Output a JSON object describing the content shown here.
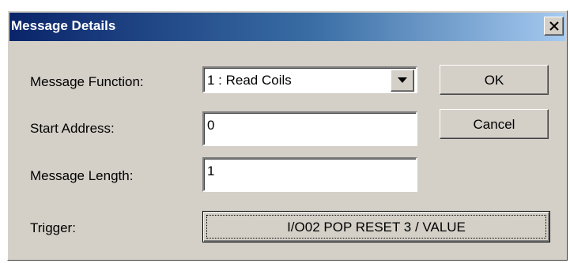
{
  "dialog": {
    "title": "Message Details",
    "close_icon": "close-icon"
  },
  "form": {
    "message_function_label": "Message Function:",
    "message_function_value": "1 : Read Coils",
    "start_address_label": "Start Address:",
    "start_address_value": "0",
    "message_length_label": "Message Length:",
    "message_length_value": "1",
    "trigger_label": "Trigger:",
    "trigger_value": "I/O02 POP RESET 3 / VALUE"
  },
  "buttons": {
    "ok_label": "OK",
    "cancel_label": "Cancel"
  },
  "colors": {
    "dialog_face": "#d4d0c8",
    "titlebar_start": "#0a246a",
    "titlebar_end": "#a6caf0",
    "title_text": "#ffffff"
  }
}
